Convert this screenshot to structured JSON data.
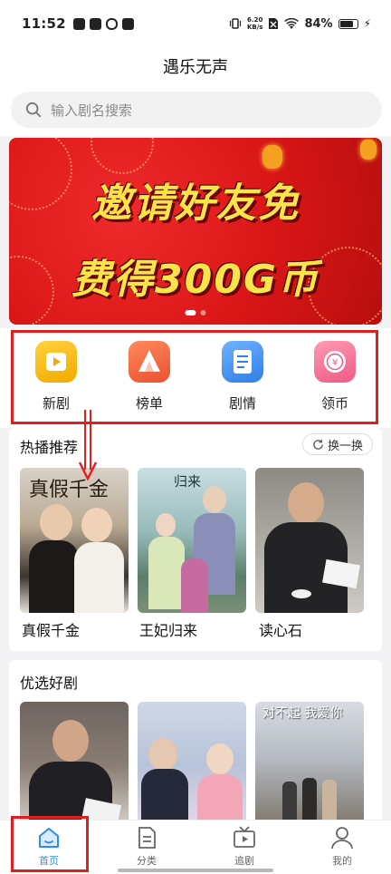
{
  "status_bar": {
    "time": "11:52",
    "net_speed_value": "6.20",
    "net_speed_unit": "KB/s",
    "battery_percent": "84%"
  },
  "header": {
    "title": "遇乐无声"
  },
  "search": {
    "placeholder": "输入剧名搜索"
  },
  "banner": {
    "line1": "邀请好友免",
    "line2": "费得300G币",
    "page_count": 2,
    "active_page": 1
  },
  "quick_nav": {
    "items": [
      {
        "label": "新剧",
        "icon": "play-video-icon",
        "color": "#f5b50a"
      },
      {
        "label": "榜单",
        "icon": "rank-crown-icon",
        "color": "#f06a45"
      },
      {
        "label": "剧情",
        "icon": "document-icon",
        "color": "#3f8ff0"
      },
      {
        "label": "领币",
        "icon": "coin-icon",
        "color": "#f2779a"
      }
    ]
  },
  "hot": {
    "title": "热播推荐",
    "refresh_label": "换一换",
    "items": [
      {
        "title": "真假千金",
        "poster_caption": "真假千金"
      },
      {
        "title": "王妃归来",
        "poster_caption": "归来"
      },
      {
        "title": "读心石",
        "poster_caption": ""
      }
    ]
  },
  "featured": {
    "title": "优选好剧",
    "posters": [
      {
        "caption": ""
      },
      {
        "caption": ""
      },
      {
        "caption": "对不起 我爱你"
      }
    ]
  },
  "bottom_nav": {
    "items": [
      {
        "label": "首页",
        "icon": "home-icon",
        "active": true
      },
      {
        "label": "分类",
        "icon": "category-icon",
        "active": false
      },
      {
        "label": "追剧",
        "icon": "tv-icon",
        "active": false
      },
      {
        "label": "我的",
        "icon": "user-icon",
        "active": false
      }
    ]
  },
  "colors": {
    "accent": "#2d8cf0",
    "annotation_red": "#e02020",
    "banner_text": "#fbe34a"
  }
}
